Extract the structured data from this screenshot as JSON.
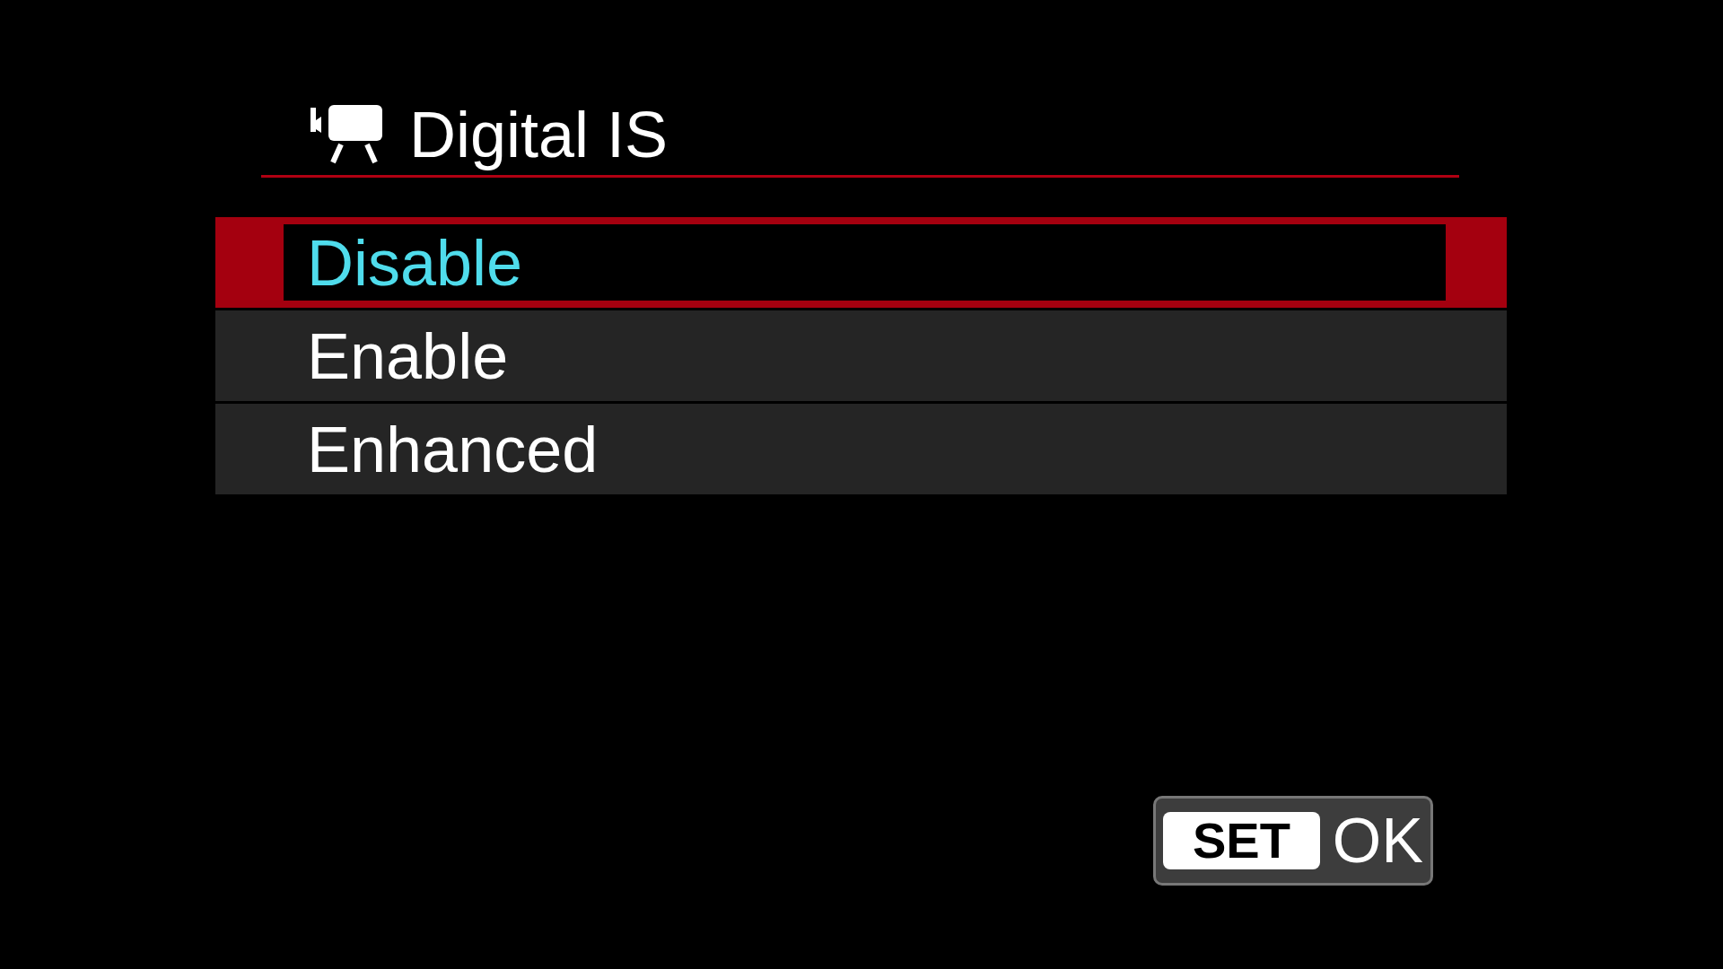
{
  "menu": {
    "title": "Digital IS",
    "options": [
      {
        "label": "Disable",
        "selected": true
      },
      {
        "label": "Enable",
        "selected": false
      },
      {
        "label": "Enhanced",
        "selected": false
      }
    ],
    "confirm": {
      "key": "SET",
      "label": "OK"
    }
  }
}
